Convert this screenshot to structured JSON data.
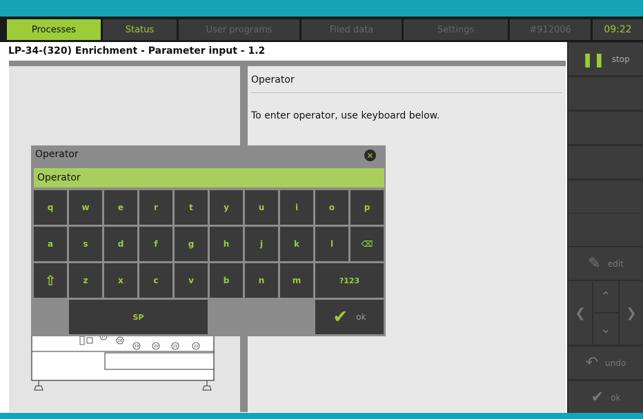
{
  "nav": {
    "tabs": [
      {
        "label": "Processes"
      },
      {
        "label": "Status"
      },
      {
        "label": "User programs"
      },
      {
        "label": "Filed data"
      },
      {
        "label": "Settings"
      },
      {
        "label": "#912006"
      }
    ],
    "time": "09:22"
  },
  "page": {
    "title": "LP-34-(320) Enrichment - Parameter input - 1.2"
  },
  "content": {
    "heading": "Operator",
    "hint": "To enter operator, use keyboard below."
  },
  "sidebar": {
    "stop_label": "stop",
    "edit_label": "edit",
    "undo_label": "undo",
    "ok_label": "ok"
  },
  "dialog": {
    "title": "Operator",
    "field_value": "Operator",
    "keys_row1": [
      "q",
      "w",
      "e",
      "r",
      "t",
      "y",
      "u",
      "i",
      "o",
      "p"
    ],
    "keys_row2": [
      "a",
      "s",
      "d",
      "f",
      "g",
      "h",
      "j",
      "k",
      "l"
    ],
    "keys_row3": [
      "z",
      "x",
      "c",
      "v",
      "b",
      "n",
      "m"
    ],
    "num_key": "?123",
    "space_key": "SP",
    "ok_key": "ok"
  },
  "device": {
    "terminal_numbers": [
      "17",
      "18",
      "19",
      "20",
      "21",
      "22"
    ]
  },
  "colors": {
    "accent": "#9ccc3a",
    "teal": "#17a2b8",
    "dark": "#2e2e2e"
  }
}
